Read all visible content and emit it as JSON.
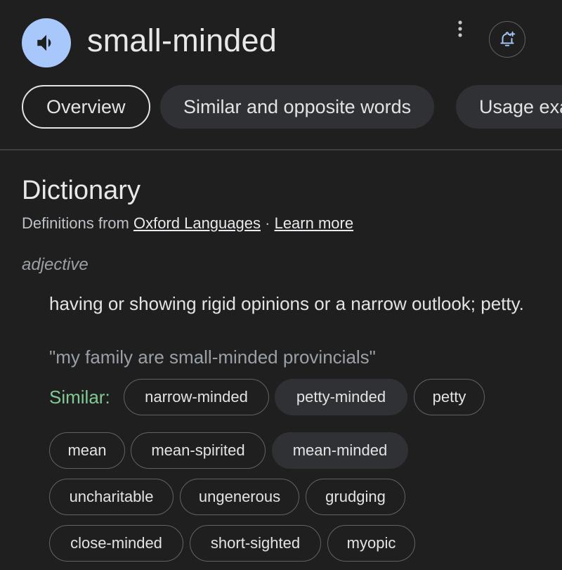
{
  "header": {
    "word": "small-minded",
    "icons": {
      "audio": "speaker-icon",
      "menu": "more-vert-icon",
      "alert": "bell-add-icon"
    }
  },
  "tabs": [
    {
      "label": "Overview",
      "active": true
    },
    {
      "label": "Similar and opposite words",
      "active": false
    },
    {
      "label": "Usage examples",
      "active": false
    }
  ],
  "dictionary": {
    "title": "Dictionary",
    "source_prefix": "Definitions from",
    "source_link": "Oxford Languages",
    "separator": "·",
    "learn_more": "Learn more",
    "part_of_speech": "adjective",
    "definition": "having or showing rigid opinions or a narrow outlook; petty.",
    "example": "\"my family are small-minded provincials\"",
    "similar_label": "Similar:",
    "similar_words": [
      "narrow-minded",
      "petty-minded",
      "petty",
      "mean",
      "mean-spirited",
      "mean-minded",
      "uncharitable",
      "ungenerous",
      "grudging",
      "close-minded",
      "short-sighted",
      "myopic"
    ]
  },
  "colors": {
    "background": "#1f1f1f",
    "accent_blue": "#a8c7fa",
    "similar_green": "#81c995",
    "chip_fill": "#303134"
  }
}
